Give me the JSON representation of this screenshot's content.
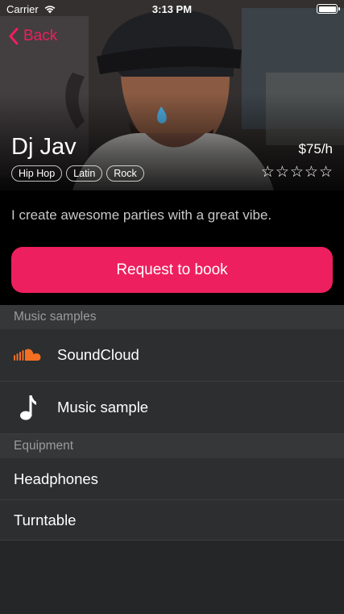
{
  "status_bar": {
    "carrier": "Carrier",
    "time": "3:13 PM",
    "battery_level": 1.0
  },
  "nav": {
    "back_label": "Back",
    "accent_color": "#ee1f5e"
  },
  "hero": {
    "dj_name": "Dj Jav",
    "price": "$75/h",
    "genres": [
      "Hip Hop",
      "Latin",
      "Rock"
    ],
    "rating": {
      "filled": 0,
      "max": 5,
      "glyph": "☆"
    }
  },
  "description": "I create awesome parties with a great vibe.",
  "request_button": {
    "label": "Request to book",
    "color": "#ee1f5e"
  },
  "sections": {
    "music": {
      "header": "Music samples",
      "items": [
        {
          "label": "SoundCloud",
          "icon": "soundcloud-icon",
          "icon_color": "#f26f23"
        },
        {
          "label": "Music sample",
          "icon": "music-note-icon",
          "icon_color": "#ffffff"
        }
      ]
    },
    "equipment": {
      "header": "Equipment",
      "items": [
        {
          "label": "Headphones"
        },
        {
          "label": "Turntable"
        }
      ]
    }
  }
}
